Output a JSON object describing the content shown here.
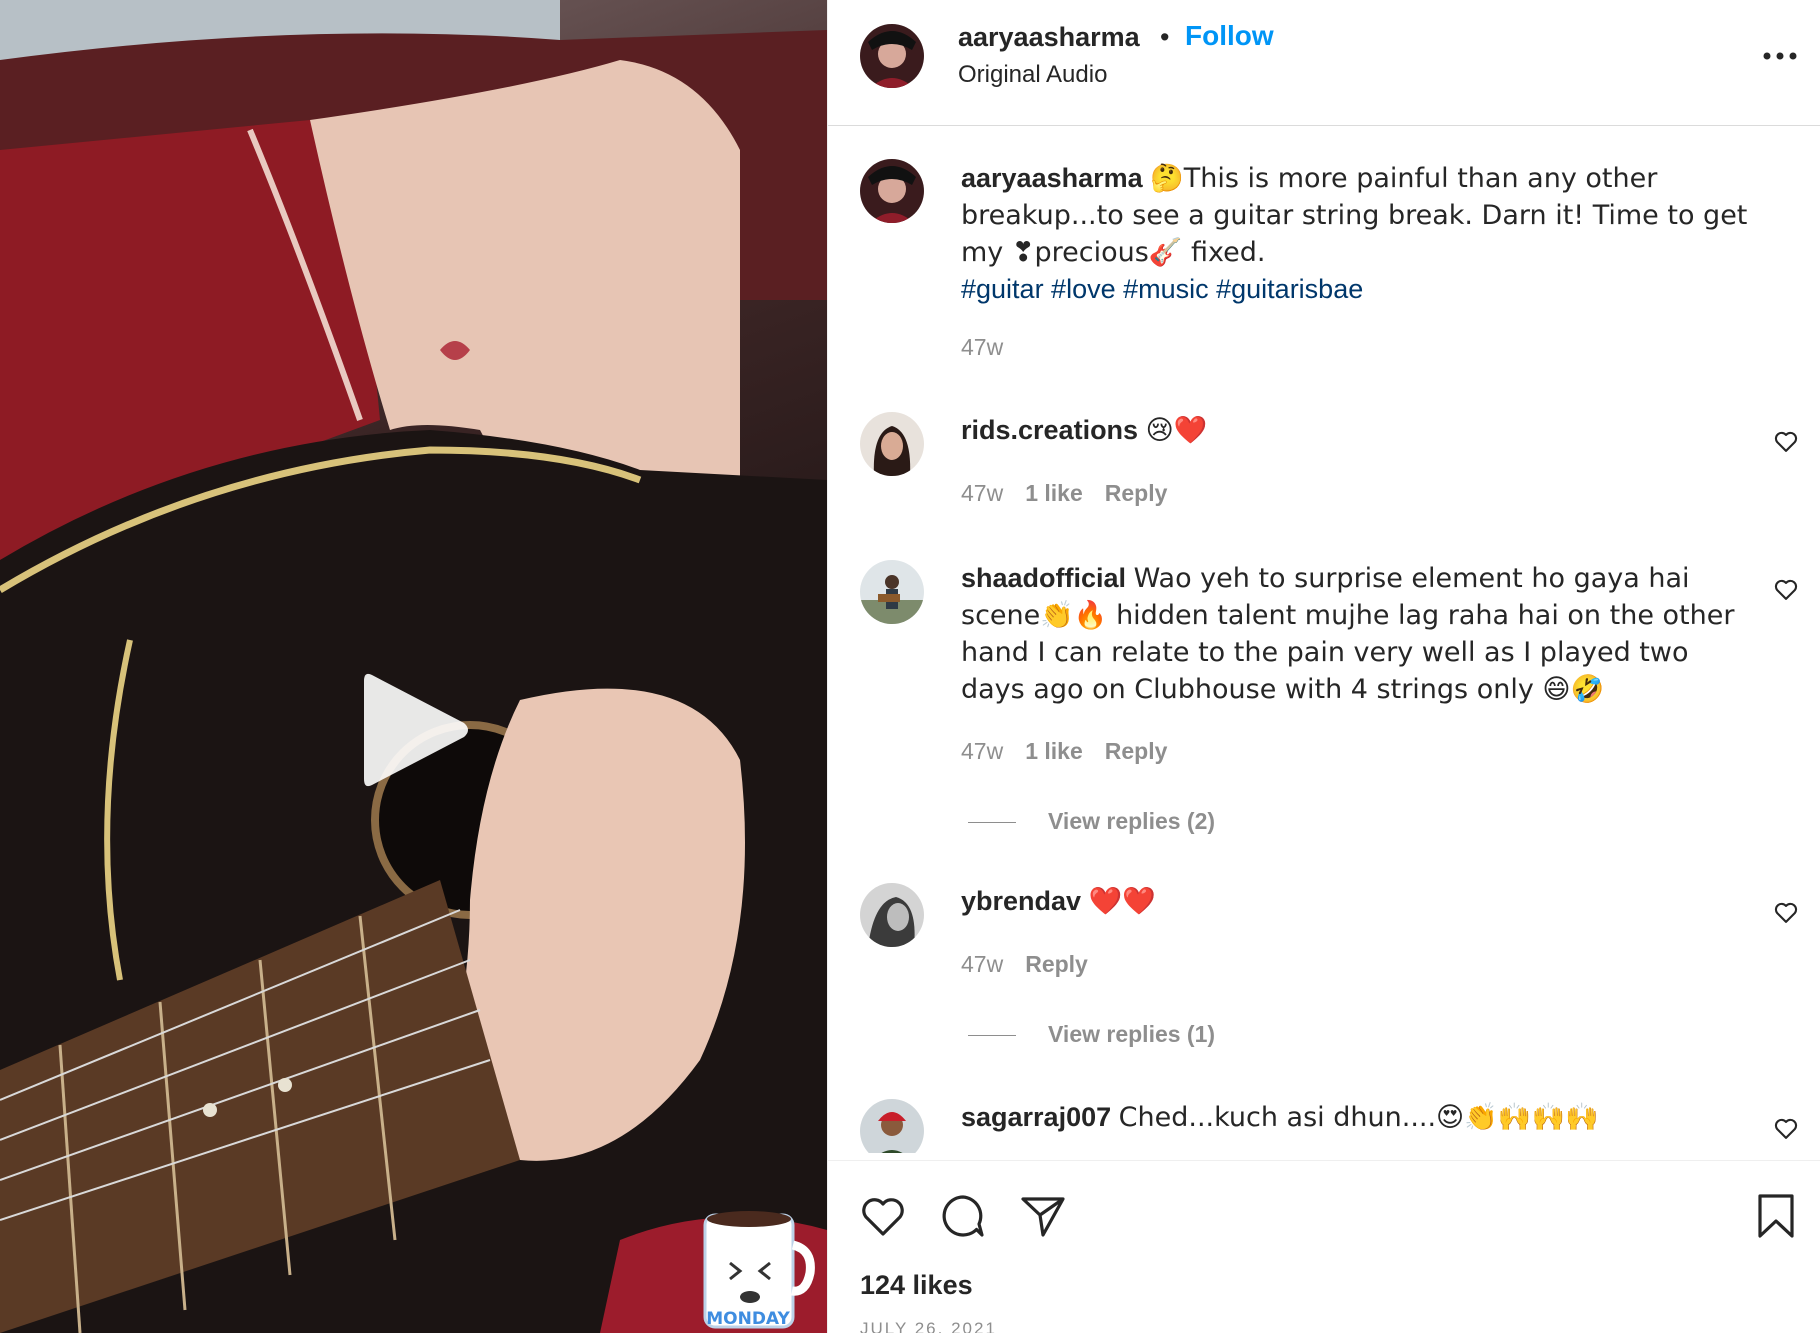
{
  "post": {
    "username": "aaryaasharma",
    "separator": "•",
    "follow_label": "Follow",
    "audio_label": "Original Audio"
  },
  "caption": {
    "username": "aaryaasharma",
    "text": "🤔This is more painful than any other breakup...to see a guitar string break. Darn it! Time to get my ❣precious🎸 fixed.",
    "hashtags": "#guitar #love #music #guitarisbae",
    "timestamp": "47w"
  },
  "comments": [
    {
      "username": "rids.creations",
      "text": "😢❤️",
      "time": "47w",
      "likes": "1 like",
      "reply_label": "Reply"
    },
    {
      "username": "shaadofficial",
      "text": "Wao yeh to surprise element ho gaya hai scene👏🔥 hidden talent mujhe lag raha hai on the other hand I can relate to the pain very well as I played two days ago on Clubhouse with 4 strings only 😄🤣",
      "time": "47w",
      "likes": "1 like",
      "reply_label": "Reply",
      "view_replies": "View replies (2)"
    },
    {
      "username": "ybrendav",
      "text": "❤️❤️",
      "time": "47w",
      "reply_label": "Reply",
      "view_replies": "View replies (1)"
    },
    {
      "username": "sagarraj007",
      "text": "Ched...kuch asi dhun....😍👏🙌🙌🙌"
    }
  ],
  "actions": {
    "likes_count": "124 likes",
    "date": "JULY 26, 2021"
  },
  "media": {
    "sticker_text": "MONDAY"
  },
  "icons": {
    "play": "play-icon",
    "more": "more-options-icon",
    "like": "heart-icon",
    "comment": "comment-icon",
    "share": "share-icon",
    "save": "bookmark-icon"
  },
  "colors": {
    "accent": "#0095f6",
    "hashtag": "#00376b",
    "muted": "#8e8e8e"
  }
}
